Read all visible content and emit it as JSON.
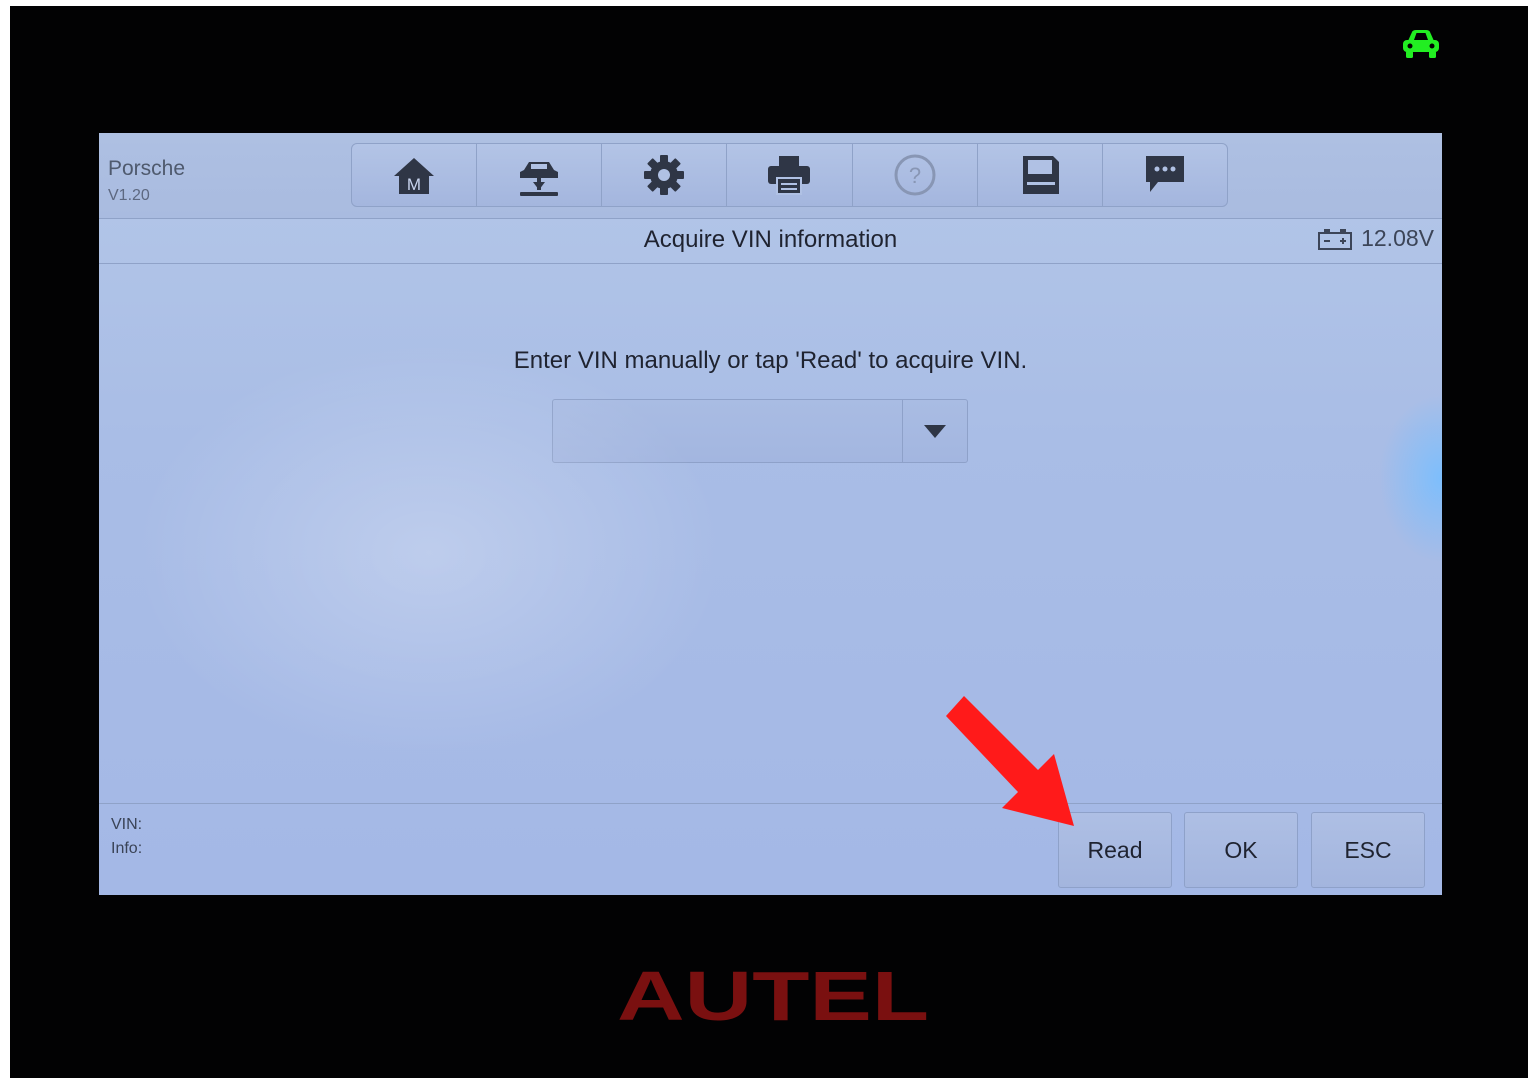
{
  "app": {
    "brand": "Porsche",
    "version": "V1.20"
  },
  "toolbar": {
    "icons": [
      "home-icon",
      "vehicle-lift-icon",
      "gear-icon",
      "printer-icon",
      "help-icon",
      "save-icon",
      "message-icon"
    ]
  },
  "header": {
    "title": "Acquire VIN information",
    "voltage": "12.08V"
  },
  "main": {
    "prompt": "Enter VIN manually or tap 'Read' to acquire VIN.",
    "vin_value": "",
    "vin_placeholder": ""
  },
  "footer": {
    "vin_label": "VIN:",
    "info_label": "Info:",
    "read_label": "Read",
    "ok_label": "OK",
    "esc_label": "ESC"
  },
  "device": {
    "logo_text": "AUTEL"
  },
  "colors": {
    "screen": "#a9bce3",
    "accent_arrow": "#ff1a1a",
    "logo": "#7a1010",
    "status_car": "#22ee22"
  }
}
